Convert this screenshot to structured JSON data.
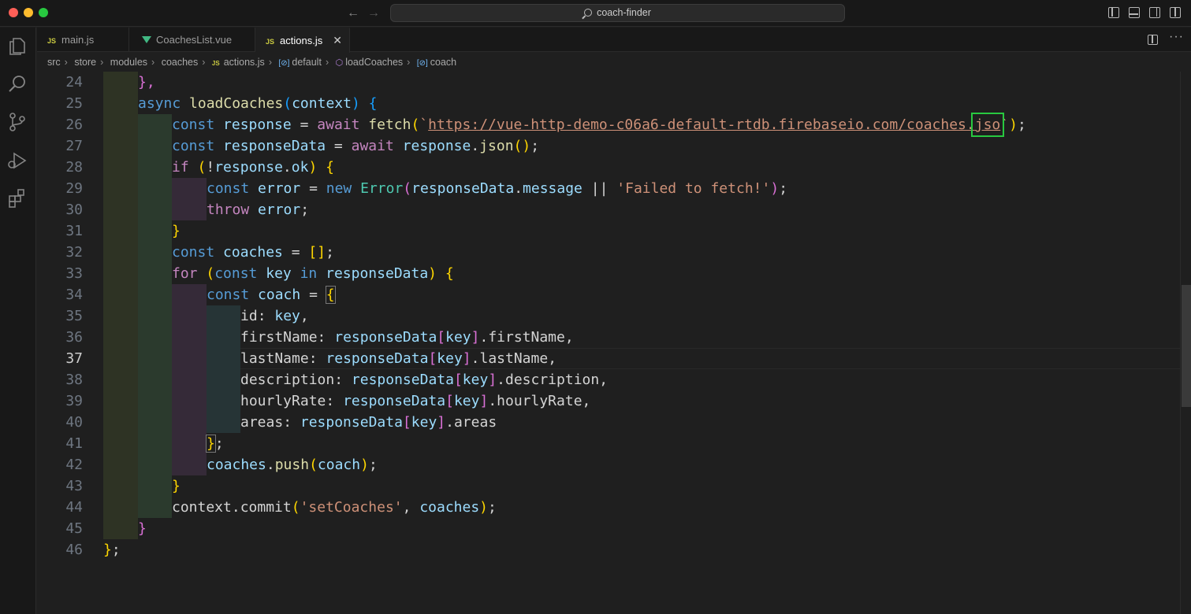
{
  "window": {
    "title": "coach-finder"
  },
  "activity_bar": [
    "files-icon",
    "search-icon",
    "source-control-icon",
    "run-debug-icon",
    "extensions-icon"
  ],
  "tabs": [
    {
      "label": "main.js",
      "icon": "js-icon"
    },
    {
      "label": "CoachesList.vue",
      "icon": "vue-icon"
    },
    {
      "label": "actions.js",
      "icon": "js-icon",
      "active": true
    }
  ],
  "breadcrumb": [
    "src",
    "store",
    "modules",
    "coaches",
    "actions.js",
    "default",
    "loadCoaches",
    "coach"
  ],
  "editor": {
    "active_line": 37,
    "lines": [
      {
        "n": "24"
      },
      {
        "n": "25"
      },
      {
        "n": "26"
      },
      {
        "n": "27"
      },
      {
        "n": "28"
      },
      {
        "n": "29"
      },
      {
        "n": "30"
      },
      {
        "n": "31"
      },
      {
        "n": "32"
      },
      {
        "n": "33"
      },
      {
        "n": "34"
      },
      {
        "n": "35"
      },
      {
        "n": "36"
      },
      {
        "n": "37"
      },
      {
        "n": "38"
      },
      {
        "n": "39"
      },
      {
        "n": "40"
      },
      {
        "n": "41"
      },
      {
        "n": "42"
      },
      {
        "n": "43"
      },
      {
        "n": "44"
      },
      {
        "n": "45"
      },
      {
        "n": "46"
      }
    ],
    "code": {
      "l24": "},",
      "l25_kw": "async",
      "l25_fn": "loadCoaches",
      "l25_p": "context",
      "l26_kw": "const",
      "l26_v": "response",
      "l26_aw": "await",
      "l26_fn": "fetch",
      "l26_url": "https://vue-http-demo-c06a6-default-rtdb.firebaseio.com/coaches.",
      "l26_ext": "jso",
      "l27_kw": "const",
      "l27_v": "responseData",
      "l27_aw": "await",
      "l27_o": "response",
      "l27_m": "json",
      "l28_kw": "if",
      "l28_v": "response",
      "l28_p": "ok",
      "l29_kw": "const",
      "l29_v": "error",
      "l29_new": "new",
      "l29_cls": "Error",
      "l29_o": "responseData",
      "l29_p": "message",
      "l29_s": "'Failed to fetch!'",
      "l30_kw": "throw",
      "l30_v": "error",
      "l32_kw": "const",
      "l32_v": "coaches",
      "l33_kw": "for",
      "l33_c": "const",
      "l33_v": "key",
      "l33_in": "in",
      "l33_o": "responseData",
      "l34_kw": "const",
      "l34_v": "coach",
      "l35_k": "id",
      "l35_v": "key",
      "l36_k": "firstName",
      "l36_o": "responseData",
      "l36_i": "key",
      "l36_p": "firstName",
      "l37_k": "lastName",
      "l37_o": "responseData",
      "l37_i": "key",
      "l37_p": "lastName",
      "l38_k": "description",
      "l38_o": "responseData",
      "l38_i": "key",
      "l38_p": "description",
      "l39_k": "hourlyRate",
      "l39_o": "responseData",
      "l39_i": "key",
      "l39_p": "hourlyRate",
      "l40_k": "areas",
      "l40_o": "responseData",
      "l40_i": "key",
      "l40_p": "areas",
      "l42_o": "coaches",
      "l42_m": "push",
      "l42_a": "coach",
      "l44_o": "context",
      "l44_m": "commit",
      "l44_s": "'setCoaches'",
      "l44_a": "coaches"
    }
  },
  "colors": {
    "highlight_box": "#28c840",
    "keyword": "#569cd6",
    "control": "#c586c0",
    "function": "#dcdcaa",
    "variable": "#9cdcfe",
    "string": "#ce9178"
  }
}
